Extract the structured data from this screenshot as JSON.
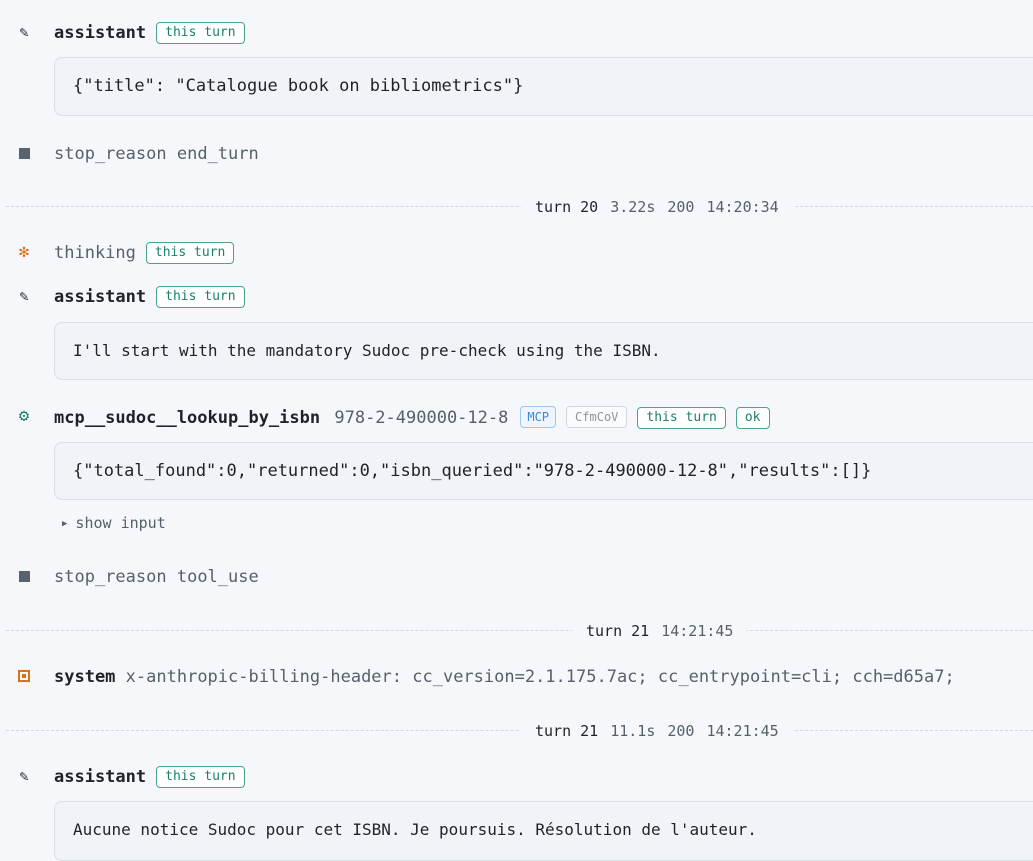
{
  "events": {
    "assistant1": {
      "role": "assistant",
      "badge": "this turn",
      "content": "{\"title\": \"Catalogue book on bibliometrics\"}"
    },
    "stop1": {
      "label": "stop_reason",
      "value": "end_turn"
    },
    "turn20": {
      "turn": "turn 20",
      "duration": "3.22s",
      "status": "200",
      "time": "14:20:34"
    },
    "thinking": {
      "role": "thinking",
      "badge": "this turn"
    },
    "assistant2": {
      "role": "assistant",
      "badge": "this turn",
      "content": "I'll start with the mandatory Sudoc pre-check using the ISBN."
    },
    "tool": {
      "name": "mcp__sudoc__lookup_by_isbn",
      "arg": "978-2-490000-12-8",
      "badge_mcp": "MCP",
      "badge_id": "CfmCoV",
      "badge_turn": "this turn",
      "badge_status": "ok",
      "result": "{\"total_found\":0,\"returned\":0,\"isbn_queried\":\"978-2-490000-12-8\",\"results\":[]}",
      "show_input": "show input"
    },
    "stop2": {
      "label": "stop_reason",
      "value": "tool_use"
    },
    "turn21a": {
      "turn": "turn 21",
      "time": "14:21:45"
    },
    "system": {
      "role": "system",
      "content": "x-anthropic-billing-header: cc_version=2.1.175.7ac; cc_entrypoint=cli; cch=d65a7;"
    },
    "turn21b": {
      "turn": "turn 21",
      "duration": "11.1s",
      "status": "200",
      "time": "14:21:45"
    },
    "assistant3": {
      "role": "assistant",
      "badge": "this turn",
      "content": "Aucune notice Sudoc pour cet ISBN. Je poursuis. Résolution de l'auteur."
    }
  },
  "icons": {
    "assistant": "pencil-icon",
    "stop": "stop-square-icon",
    "thinking": "sparkle-icon",
    "tool": "gear-icon",
    "system": "system-square-icon",
    "expand": "triangle-right-icon"
  },
  "colors": {
    "accent_teal": "#1a7f6b",
    "accent_orange": "#d9731a",
    "mcp_blue": "#3a86d8"
  }
}
